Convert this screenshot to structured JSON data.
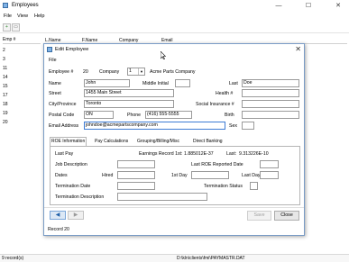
{
  "window": {
    "title": "Employees",
    "min_glyph": "—",
    "max_glyph": "☐",
    "close_glyph": "✕"
  },
  "menubar": {
    "file": "File",
    "view": "View",
    "help": "Help"
  },
  "toolbar": {
    "add_icon": "add-icon",
    "print_icon": "print-icon",
    "add_glyph": "+",
    "print_glyph": "▭"
  },
  "grid": {
    "row_header": "Emp #",
    "columns": [
      "L.Name",
      "F.Name",
      "Company",
      "Email"
    ],
    "row_numbers": [
      "2",
      "3",
      "11",
      "14",
      "15",
      "17",
      "18",
      "19",
      "20"
    ]
  },
  "status": {
    "records": "9 record(s)",
    "path": "D:\\kln\\clients\\fmi\\PAYMASTR.DAT"
  },
  "dialog": {
    "title": "Edit Employee",
    "close_glyph": "✕",
    "menu_file": "File",
    "labels": {
      "emp_no": "Employee #",
      "company": "Company",
      "name": "Name",
      "middle_initial": "Middle Initial",
      "last": "Last",
      "street": "Street",
      "health": "Health #",
      "city": "City/Province",
      "sin": "Social Insurance #",
      "postal": "Postal Code",
      "phone": "Phone",
      "birth": "Birth",
      "email": "Email Address",
      "sex": "Sex"
    },
    "values": {
      "emp_no": "20",
      "company_no": "1",
      "company_name": "Acme Parts Company",
      "first": "John",
      "middle_initial": "",
      "last": "Doe",
      "street": "1455 Main Street",
      "health": "",
      "city": "Toronto",
      "sin": "",
      "postal": "ON",
      "phone": "(416) 555-5555",
      "birth": "",
      "email": "johndoe@acmepartscompany.com",
      "sex": ""
    },
    "tabs": [
      "ROE Information",
      "Pay Calculations",
      "Grouping/Billing/Misc",
      "Direct Banking"
    ],
    "roe": {
      "last_pay": "Last Pay",
      "earnings_record_1st_label": "Earnings Record 1st:",
      "earnings_record_1st": "1.885012E-37",
      "last_label": "Last:",
      "last_value": "9.313226E-10",
      "job_description": "Job Description",
      "last_roe_date": "Last ROE Reported Date",
      "dates": "Dates",
      "hired": "Hired",
      "first_day": "1st Day",
      "last_day": "Last Day",
      "termination_date": "Termination Date",
      "termination_status": "Termination Status",
      "termination_description": "Termination Description"
    },
    "buttons": {
      "save": "Save",
      "close": "Close",
      "prev_glyph": "◀",
      "next_glyph": "▶"
    },
    "status": "Record 20"
  }
}
